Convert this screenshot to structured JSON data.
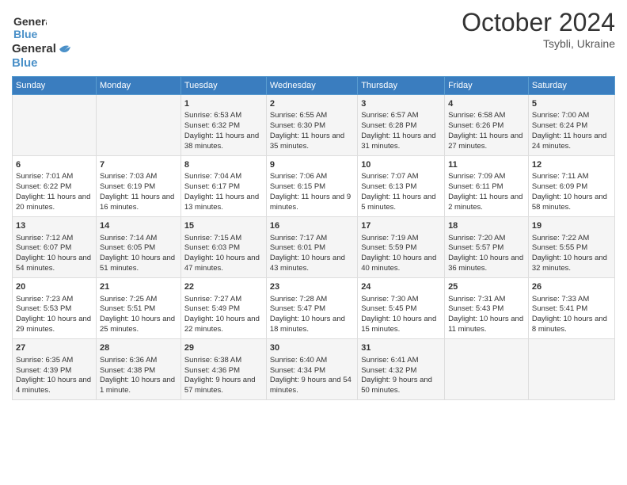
{
  "header": {
    "logo_line1": "General",
    "logo_line2": "Blue",
    "month": "October 2024",
    "location": "Tsybli, Ukraine"
  },
  "days_of_week": [
    "Sunday",
    "Monday",
    "Tuesday",
    "Wednesday",
    "Thursday",
    "Friday",
    "Saturday"
  ],
  "weeks": [
    [
      {
        "day": "",
        "info": ""
      },
      {
        "day": "",
        "info": ""
      },
      {
        "day": "1",
        "sunrise": "Sunrise: 6:53 AM",
        "sunset": "Sunset: 6:32 PM",
        "daylight": "Daylight: 11 hours and 38 minutes."
      },
      {
        "day": "2",
        "sunrise": "Sunrise: 6:55 AM",
        "sunset": "Sunset: 6:30 PM",
        "daylight": "Daylight: 11 hours and 35 minutes."
      },
      {
        "day": "3",
        "sunrise": "Sunrise: 6:57 AM",
        "sunset": "Sunset: 6:28 PM",
        "daylight": "Daylight: 11 hours and 31 minutes."
      },
      {
        "day": "4",
        "sunrise": "Sunrise: 6:58 AM",
        "sunset": "Sunset: 6:26 PM",
        "daylight": "Daylight: 11 hours and 27 minutes."
      },
      {
        "day": "5",
        "sunrise": "Sunrise: 7:00 AM",
        "sunset": "Sunset: 6:24 PM",
        "daylight": "Daylight: 11 hours and 24 minutes."
      }
    ],
    [
      {
        "day": "6",
        "sunrise": "Sunrise: 7:01 AM",
        "sunset": "Sunset: 6:22 PM",
        "daylight": "Daylight: 11 hours and 20 minutes."
      },
      {
        "day": "7",
        "sunrise": "Sunrise: 7:03 AM",
        "sunset": "Sunset: 6:19 PM",
        "daylight": "Daylight: 11 hours and 16 minutes."
      },
      {
        "day": "8",
        "sunrise": "Sunrise: 7:04 AM",
        "sunset": "Sunset: 6:17 PM",
        "daylight": "Daylight: 11 hours and 13 minutes."
      },
      {
        "day": "9",
        "sunrise": "Sunrise: 7:06 AM",
        "sunset": "Sunset: 6:15 PM",
        "daylight": "Daylight: 11 hours and 9 minutes."
      },
      {
        "day": "10",
        "sunrise": "Sunrise: 7:07 AM",
        "sunset": "Sunset: 6:13 PM",
        "daylight": "Daylight: 11 hours and 5 minutes."
      },
      {
        "day": "11",
        "sunrise": "Sunrise: 7:09 AM",
        "sunset": "Sunset: 6:11 PM",
        "daylight": "Daylight: 11 hours and 2 minutes."
      },
      {
        "day": "12",
        "sunrise": "Sunrise: 7:11 AM",
        "sunset": "Sunset: 6:09 PM",
        "daylight": "Daylight: 10 hours and 58 minutes."
      }
    ],
    [
      {
        "day": "13",
        "sunrise": "Sunrise: 7:12 AM",
        "sunset": "Sunset: 6:07 PM",
        "daylight": "Daylight: 10 hours and 54 minutes."
      },
      {
        "day": "14",
        "sunrise": "Sunrise: 7:14 AM",
        "sunset": "Sunset: 6:05 PM",
        "daylight": "Daylight: 10 hours and 51 minutes."
      },
      {
        "day": "15",
        "sunrise": "Sunrise: 7:15 AM",
        "sunset": "Sunset: 6:03 PM",
        "daylight": "Daylight: 10 hours and 47 minutes."
      },
      {
        "day": "16",
        "sunrise": "Sunrise: 7:17 AM",
        "sunset": "Sunset: 6:01 PM",
        "daylight": "Daylight: 10 hours and 43 minutes."
      },
      {
        "day": "17",
        "sunrise": "Sunrise: 7:19 AM",
        "sunset": "Sunset: 5:59 PM",
        "daylight": "Daylight: 10 hours and 40 minutes."
      },
      {
        "day": "18",
        "sunrise": "Sunrise: 7:20 AM",
        "sunset": "Sunset: 5:57 PM",
        "daylight": "Daylight: 10 hours and 36 minutes."
      },
      {
        "day": "19",
        "sunrise": "Sunrise: 7:22 AM",
        "sunset": "Sunset: 5:55 PM",
        "daylight": "Daylight: 10 hours and 32 minutes."
      }
    ],
    [
      {
        "day": "20",
        "sunrise": "Sunrise: 7:23 AM",
        "sunset": "Sunset: 5:53 PM",
        "daylight": "Daylight: 10 hours and 29 minutes."
      },
      {
        "day": "21",
        "sunrise": "Sunrise: 7:25 AM",
        "sunset": "Sunset: 5:51 PM",
        "daylight": "Daylight: 10 hours and 25 minutes."
      },
      {
        "day": "22",
        "sunrise": "Sunrise: 7:27 AM",
        "sunset": "Sunset: 5:49 PM",
        "daylight": "Daylight: 10 hours and 22 minutes."
      },
      {
        "day": "23",
        "sunrise": "Sunrise: 7:28 AM",
        "sunset": "Sunset: 5:47 PM",
        "daylight": "Daylight: 10 hours and 18 minutes."
      },
      {
        "day": "24",
        "sunrise": "Sunrise: 7:30 AM",
        "sunset": "Sunset: 5:45 PM",
        "daylight": "Daylight: 10 hours and 15 minutes."
      },
      {
        "day": "25",
        "sunrise": "Sunrise: 7:31 AM",
        "sunset": "Sunset: 5:43 PM",
        "daylight": "Daylight: 10 hours and 11 minutes."
      },
      {
        "day": "26",
        "sunrise": "Sunrise: 7:33 AM",
        "sunset": "Sunset: 5:41 PM",
        "daylight": "Daylight: 10 hours and 8 minutes."
      }
    ],
    [
      {
        "day": "27",
        "sunrise": "Sunrise: 6:35 AM",
        "sunset": "Sunset: 4:39 PM",
        "daylight": "Daylight: 10 hours and 4 minutes."
      },
      {
        "day": "28",
        "sunrise": "Sunrise: 6:36 AM",
        "sunset": "Sunset: 4:38 PM",
        "daylight": "Daylight: 10 hours and 1 minute."
      },
      {
        "day": "29",
        "sunrise": "Sunrise: 6:38 AM",
        "sunset": "Sunset: 4:36 PM",
        "daylight": "Daylight: 9 hours and 57 minutes."
      },
      {
        "day": "30",
        "sunrise": "Sunrise: 6:40 AM",
        "sunset": "Sunset: 4:34 PM",
        "daylight": "Daylight: 9 hours and 54 minutes."
      },
      {
        "day": "31",
        "sunrise": "Sunrise: 6:41 AM",
        "sunset": "Sunset: 4:32 PM",
        "daylight": "Daylight: 9 hours and 50 minutes."
      },
      {
        "day": "",
        "info": ""
      },
      {
        "day": "",
        "info": ""
      }
    ]
  ]
}
